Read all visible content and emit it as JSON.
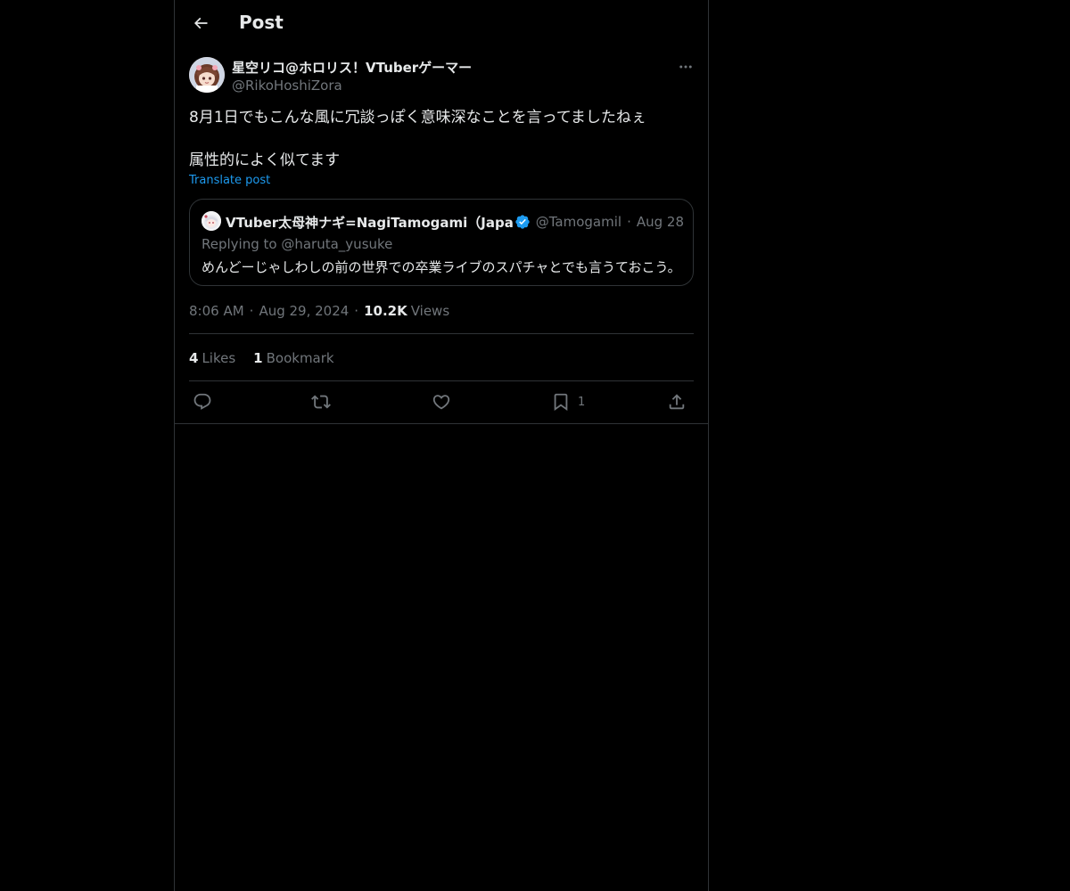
{
  "header": {
    "title": "Post"
  },
  "post": {
    "author_name": "星空リコ@ホロリス！VTuberゲーマー",
    "author_handle": "@RikoHoshiZora",
    "text_lines": [
      "8月1日でもこんな風に冗談っぽく意味深なことを言ってましたねぇ",
      "属性的によく似てます"
    ],
    "translate_label": "Translate post",
    "time": "8:06 AM",
    "date": "Aug 29, 2024",
    "views_count": "10.2K",
    "views_label": "Views"
  },
  "quote": {
    "name": "VTuber太母神ナギ=NagiTamogami（Japanese",
    "handle": "@Tamogamil",
    "date": "Aug 28",
    "replying_prefix": "Replying to",
    "replying_to": "@haruta_yusuke",
    "text": "めんどーじゃしわしの前の世界での卒業ライブのスパチャとでも言うておこう。"
  },
  "stats": {
    "likes_count": "4",
    "likes_label": "Likes",
    "bookmarks_count": "1",
    "bookmarks_label": "Bookmark"
  },
  "actions": {
    "bookmark_count": "1"
  },
  "colors": {
    "background": "#000000",
    "text": "#e7e9ea",
    "secondary": "#71767b",
    "accent": "#1d9bf0",
    "border": "#2f3336"
  },
  "icons": {
    "back": "arrow-left-icon",
    "more": "more-horizontal-icon",
    "verified": "verified-badge-icon",
    "reply": "reply-icon",
    "repost": "repost-icon",
    "like": "heart-icon",
    "bookmark": "bookmark-icon",
    "share": "share-icon"
  }
}
